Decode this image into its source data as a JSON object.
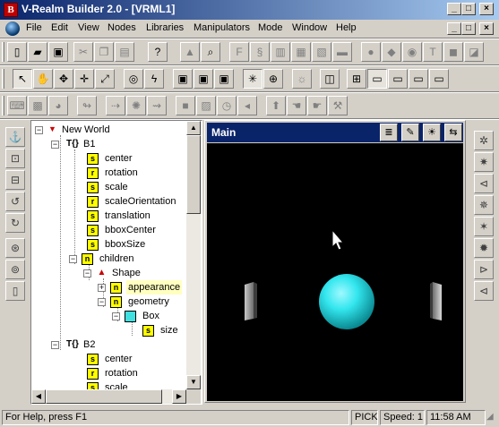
{
  "window": {
    "title": "V-Realm Builder 2.0 - [VRML1]",
    "app_icon_letter": "B",
    "minimize": "_",
    "maximize": "□",
    "close": "×"
  },
  "menu": {
    "items": [
      "File",
      "Edit",
      "View",
      "Nodes",
      "Libraries",
      "Manipulators",
      "Mode",
      "Window",
      "Help"
    ]
  },
  "toolbar1": {
    "icons": [
      "new-file-icon",
      "open-folder-icon",
      "save-icon",
      "cut-icon",
      "copy-icon",
      "paste-icon",
      "help-icon",
      "node-library-icon",
      "search-icon",
      "fontstyle-icon",
      "script-icon",
      "node-icon",
      "node-icon",
      "node-icon",
      "node-icon",
      "shape-icon",
      "shape-icon",
      "shape-icon",
      "text-icon",
      "shape-icon",
      "shape-icon"
    ]
  },
  "toolbar2": {
    "icons": [
      "pointer-icon",
      "grab-icon",
      "move-icon",
      "pan-icon",
      "select-icon",
      "camera-icon",
      "lightning-icon",
      "view-icon",
      "view-icon",
      "view-icon",
      "navigate-icon",
      "globe-icon",
      "light-icon",
      "single-view-icon",
      "quad-view-icon",
      "view-layout-icon",
      "view-layout-icon",
      "view-layout-icon"
    ]
  },
  "toolbar3": {
    "icons": [
      "keyboard-icon",
      "cube-icon",
      "sphere-icon",
      "route-icon",
      "pointlight-icon",
      "spotlight-icon",
      "box-node-icon",
      "image-icon",
      "clock-icon",
      "sound-icon",
      "touch-sensor-icon",
      "hand-icon",
      "hand-icon",
      "wrench-icon"
    ]
  },
  "left_sidebar": {
    "icons": [
      "anchor-icon",
      "sensor-icon",
      "sensor-icon",
      "switch-icon",
      "lod-icon",
      "billboard-icon",
      "collision-icon",
      "inline-icon"
    ]
  },
  "right_sidebar": {
    "icons": [
      "light-bulb-icon",
      "light-bulb-icon",
      "light-bulb-icon",
      "light-bulb-icon",
      "light-bulb-icon",
      "light-bulb-icon",
      "light-bulb-icon",
      "light-bulb-icon"
    ]
  },
  "tree": {
    "root": "New World",
    "B1": "B1",
    "center": "center",
    "rotation": "rotation",
    "scale": "scale",
    "scaleOrientation": "scaleOrientation",
    "translation": "translation",
    "bboxCenter": "bboxCenter",
    "bboxSize": "bboxSize",
    "children": "children",
    "shape": "Shape",
    "appearance": "appearance",
    "geometry": "geometry",
    "box": "Box",
    "size": "size",
    "B2": "B2",
    "center2": "center",
    "rotation2": "rotation",
    "scale2": "scale",
    "field_r": "r",
    "field_s": "s",
    "field_n": "n",
    "group_marker": "T{}"
  },
  "viewport": {
    "title": "Main",
    "background": "#000000",
    "sphere_color": "#33e6ee"
  },
  "status": {
    "help": "For Help, press F1",
    "mode": "PICK",
    "speed": "Speed: 1",
    "time": "11:58 AM"
  },
  "colors": {
    "title_start": "#0a246a",
    "title_end": "#a6caf0",
    "face": "#d4d0c8",
    "selection": "#ffffc0"
  }
}
